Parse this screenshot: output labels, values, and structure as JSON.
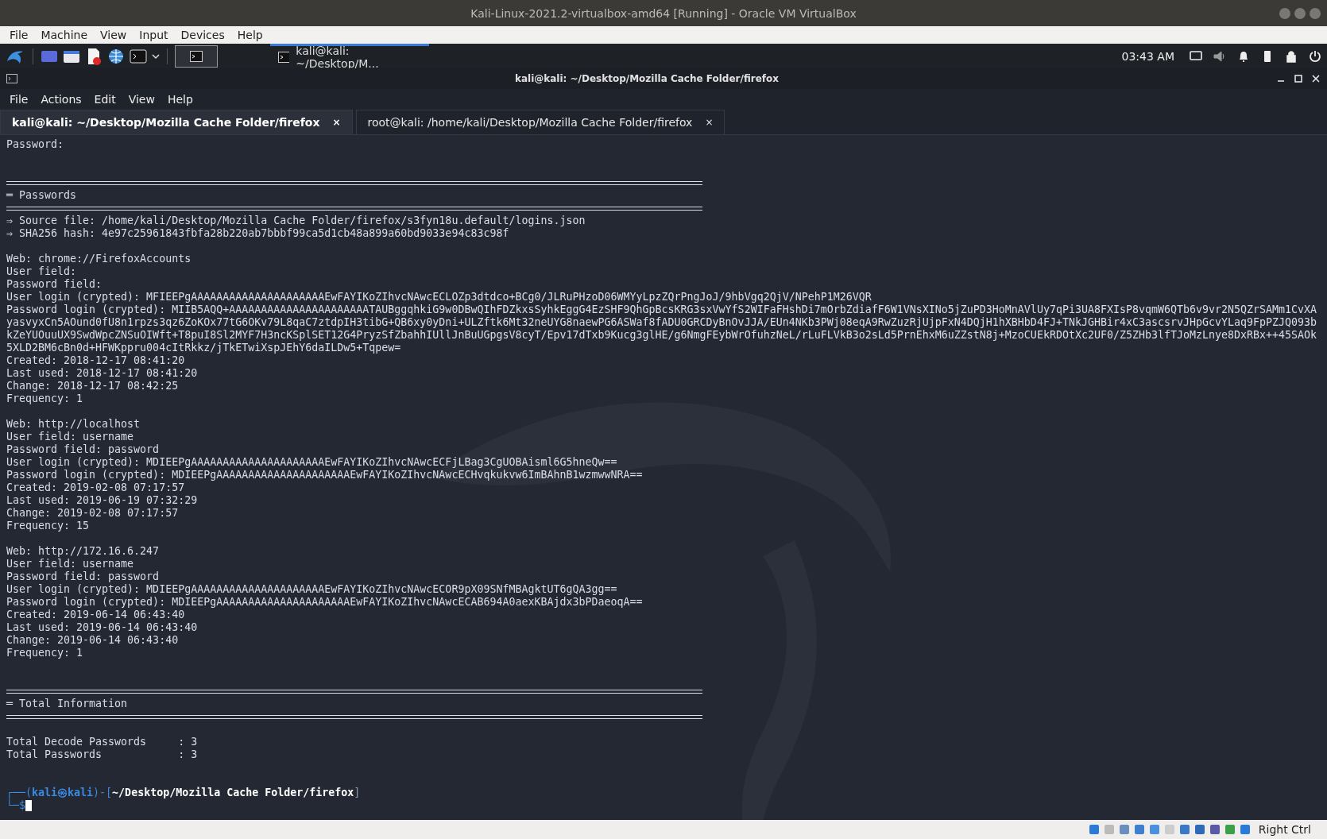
{
  "window": {
    "title": "Kali-Linux-2021.2-virtualbox-amd64 [Running] - Oracle VM VirtualBox"
  },
  "vm_menu": [
    "File",
    "Machine",
    "View",
    "Input",
    "Devices",
    "Help"
  ],
  "taskbar": {
    "task": "kali@kali: ~/Desktop/M...",
    "clock": "03:43 AM"
  },
  "terminal": {
    "title": "kali@kali: ~/Desktop/Mozilla Cache Folder/firefox",
    "menu": [
      "File",
      "Actions",
      "Edit",
      "View",
      "Help"
    ],
    "tabs": [
      {
        "label": "kali@kali: ~/Desktop/Mozilla Cache Folder/firefox",
        "close": "×",
        "selected": true
      },
      {
        "label": "root@kali: /home/kali/Desktop/Mozilla Cache Folder/firefox",
        "close": "×",
        "selected": false
      }
    ],
    "lines": [
      {
        "kind": "text",
        "text": "Password:"
      },
      {
        "kind": "blank"
      },
      {
        "kind": "blank"
      },
      {
        "kind": "rule"
      },
      {
        "kind": "text",
        "text": "═ Passwords"
      },
      {
        "kind": "rule"
      },
      {
        "kind": "text",
        "text": "⇒ Source file: /home/kali/Desktop/Mozilla Cache Folder/firefox/s3fyn18u.default/logins.json"
      },
      {
        "kind": "text",
        "text": "⇒ SHA256 hash: 4e97c25961843fbfa28b220ab7bbbf99ca5d1cb48a899a60bd9033e94c83c98f"
      },
      {
        "kind": "blank"
      },
      {
        "kind": "text",
        "text": "Web: chrome://FirefoxAccounts"
      },
      {
        "kind": "text",
        "text": "User field:"
      },
      {
        "kind": "text",
        "text": "Password field:"
      },
      {
        "kind": "text",
        "text": "User login (crypted): MFIEEPgAAAAAAAAAAAAAAAAAAAAAEwFAYIKoZIhvcNAwcECLOZp3dtdco+BCg0/JLRuPHzoD06WMYyLpzZQrPngJoJ/9hbVgq2QjV/NPehP1M26VQR"
      },
      {
        "kind": "text",
        "text": "Password login (crypted): MIIB5AQQ+AAAAAAAAAAAAAAAAAAAAAATAUBggqhkiG9w0DBwQIhFDZkxsSyhkEggG4EzSHF9QhGpBcsKRG3sxVwYfS2WIFaFHshDi7mOrbZdiafF6W1VNsXINo5jZuPD3HoMnAVlUy7qPi3UA8FXIsP8vqmW6QTb6v9vr2N5QZrSAMm1CvXAyasvyxCn5AOund0fU8n1rpzs3qz6ZoKOx77tG6OKv79L8qaC7ztdpIH3tibG+QB6xy0yDni+ULZftk6Mt32neUYG8naewPG6ASWaf8fADU0GRCDyBnOvJJA/EUn4NKb3PWj08eqA9RwZuzRjUjpFxN4DQjH1hXBHbD4FJ+TNkJGHBir4xC3ascsrvJHpGcvYLaq9FpPZJQ093bkZeYUOuuUX9SwdWpcZNSuOIWft+T8puI8Sl2MYF7H3ncKSplSET12G4PryzSfZbahhIUllJnBuUGpgsV8cyT/Epv17dTxb9Kucg3glHE/g6NmgFEybWrOfuhzNeL/rLuFLVkB3o2sLd5PrnEhxM6uZZstN8j+MzoCUEkRDOtXc2UF0/Z5ZHb3lfTJoMzLnye8DxRBx++45SAOk5XLD2BM6cBn0d+HFWKppru004cItRkkz/jTkETwiXspJEhY6daILDw5+Tqpew="
      },
      {
        "kind": "text",
        "text": "Created: 2018-12-17 08:41:20"
      },
      {
        "kind": "text",
        "text": "Last used: 2018-12-17 08:41:20"
      },
      {
        "kind": "text",
        "text": "Change: 2018-12-17 08:42:25"
      },
      {
        "kind": "text",
        "text": "Frequency: 1"
      },
      {
        "kind": "blank"
      },
      {
        "kind": "text",
        "text": "Web: http://localhost"
      },
      {
        "kind": "text",
        "text": "User field: username"
      },
      {
        "kind": "text",
        "text": "Password field: password"
      },
      {
        "kind": "text",
        "text": "User login (crypted): MDIEEPgAAAAAAAAAAAAAAAAAAAAAEwFAYIKoZIhvcNAwcECFjLBag3CgUOBAisml6G5hneQw=="
      },
      {
        "kind": "text",
        "text": "Password login (crypted): MDIEEPgAAAAAAAAAAAAAAAAAAAAAEwFAYIKoZIhvcNAwcECHvqkukvw6ImBAhnB1wzmwwNRA=="
      },
      {
        "kind": "text",
        "text": "Created: 2019-02-08 07:17:57"
      },
      {
        "kind": "text",
        "text": "Last used: 2019-06-19 07:32:29"
      },
      {
        "kind": "text",
        "text": "Change: 2019-02-08 07:17:57"
      },
      {
        "kind": "text",
        "text": "Frequency: 15"
      },
      {
        "kind": "blank"
      },
      {
        "kind": "text",
        "text": "Web: http://172.16.6.247"
      },
      {
        "kind": "text",
        "text": "User field: username"
      },
      {
        "kind": "text",
        "text": "Password field: password"
      },
      {
        "kind": "text",
        "text": "User login (crypted): MDIEEPgAAAAAAAAAAAAAAAAAAAAAEwFAYIKoZIhvcNAwcECOR9pX09SNfMBAgktUT6gQA3gg=="
      },
      {
        "kind": "text",
        "text": "Password login (crypted): MDIEEPgAAAAAAAAAAAAAAAAAAAAAEwFAYIKoZIhvcNAwcECAB694A0aexKBAjdx3bPDaeoqA=="
      },
      {
        "kind": "text",
        "text": "Created: 2019-06-14 06:43:40"
      },
      {
        "kind": "text",
        "text": "Last used: 2019-06-14 06:43:40"
      },
      {
        "kind": "text",
        "text": "Change: 2019-06-14 06:43:40"
      },
      {
        "kind": "text",
        "text": "Frequency: 1"
      },
      {
        "kind": "blank"
      },
      {
        "kind": "blank"
      },
      {
        "kind": "rule"
      },
      {
        "kind": "text",
        "text": "═ Total Information"
      },
      {
        "kind": "rule"
      },
      {
        "kind": "blank"
      },
      {
        "kind": "text",
        "text": "Total Decode Passwords     : 3"
      },
      {
        "kind": "text",
        "text": "Total Passwords            : 3"
      },
      {
        "kind": "blank"
      },
      {
        "kind": "blank"
      }
    ],
    "prompt": {
      "corner": "┌──(",
      "user": "kali㉿kali",
      "join": ")-[",
      "path": "~/Desktop/Mozilla Cache Folder/firefox",
      "close": "]",
      "second": "└─$"
    }
  },
  "status_bar": {
    "host_key": "Right Ctrl"
  }
}
